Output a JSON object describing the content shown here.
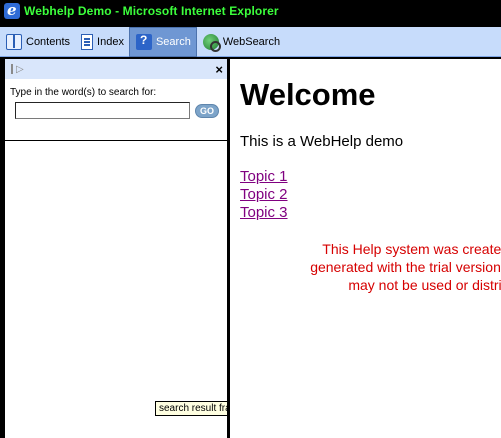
{
  "window": {
    "title": "Webhelp Demo - Microsoft Internet Explorer"
  },
  "toolbar": {
    "items": [
      {
        "label": "Contents",
        "icon": "contents-icon",
        "active": false
      },
      {
        "label": "Index",
        "icon": "index-icon",
        "active": false
      },
      {
        "label": "Search",
        "icon": "search-icon",
        "active": true
      },
      {
        "label": "WebSearch",
        "icon": "websearch-icon",
        "active": false
      }
    ]
  },
  "left_pane": {
    "close_glyph": "×",
    "search_prompt": "Type in the word(s) to search for:",
    "search_value": "",
    "go_label": "GO",
    "tooltip": "search result frame"
  },
  "content": {
    "heading": "Welcome",
    "intro": "This is a WebHelp demo",
    "topics": [
      "Topic 1",
      "Topic 2",
      "Topic 3"
    ],
    "notice_line1": "This Help system was created us",
    "notice_line2": "generated with the trial version are in",
    "notice_line3": "may not be used or distri"
  },
  "colors": {
    "title_text": "#3cff3c",
    "toolbar_bg": "#c7dcfb",
    "active_tab": "#6f97d3",
    "link_visited": "#800080",
    "notice": "#d60000"
  }
}
